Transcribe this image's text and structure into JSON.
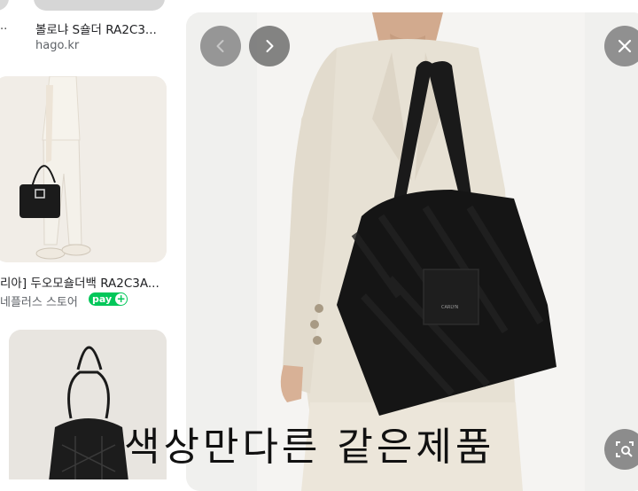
{
  "results": [
    {
      "title": "볼로냐 S숄더 RA2C3...",
      "source": "hago.kr"
    },
    {
      "title": "리아] 두오모숄더백 RA2C3A...",
      "source": "네플러스 스토어",
      "badge": "pay"
    }
  ],
  "left_edge_text": "..",
  "preview": {
    "caption": "색상만다른 같은제품",
    "brand_tag": "CARLYN"
  },
  "icons": {
    "prev": "chevron-left-icon",
    "next": "chevron-right-icon",
    "close": "close-icon",
    "lens": "image-search-icon"
  },
  "colors": {
    "npay_green": "#03c75a",
    "button_gray": "#7a7a7a",
    "bag_black": "#151515",
    "jacket_beige": "#e6e0d3"
  }
}
